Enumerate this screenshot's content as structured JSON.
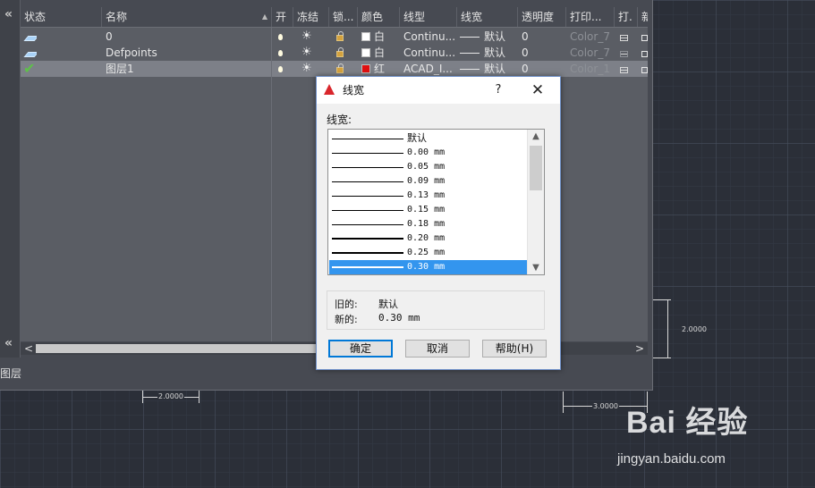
{
  "palette": {
    "columns": [
      "状态",
      "名称",
      "开",
      "冻结",
      "锁...",
      "颜色",
      "线型",
      "线宽",
      "透明度",
      "打印...",
      "打.",
      "新"
    ],
    "layers": [
      {
        "name": "0",
        "color_name": "白",
        "color_hex": "#ffffff",
        "linetype": "Continu...",
        "lineweight": "默认",
        "transparency": "0",
        "plot_style": "Color_7",
        "current": false
      },
      {
        "name": "Defpoints",
        "color_name": "白",
        "color_hex": "#ffffff",
        "linetype": "Continu...",
        "lineweight": "默认",
        "transparency": "0",
        "plot_style": "Color_7",
        "current": false
      },
      {
        "name": "图层1",
        "color_name": "红",
        "color_hex": "#e01010",
        "linetype": "ACAD_I...",
        "lineweight": "默认",
        "transparency": "0",
        "plot_style": "Color_1",
        "current": true
      }
    ],
    "side_label": "图层"
  },
  "dialog": {
    "title": "线宽",
    "help": "?",
    "close": "✕",
    "list_label": "线宽:",
    "options": [
      "默认",
      "0.00 mm",
      "0.05 mm",
      "0.09 mm",
      "0.13 mm",
      "0.15 mm",
      "0.18 mm",
      "0.20 mm",
      "0.25 mm",
      "0.30 mm"
    ],
    "selected_index": 9,
    "old_label": "旧的:",
    "old_value": "默认",
    "new_label": "新的:",
    "new_value": "0.30 mm",
    "ok": "确定",
    "cancel": "取消",
    "help_button": "帮助(H)"
  },
  "drawing": {
    "dim_height": "2.0000",
    "dim_width_left": "2.0000",
    "dim_width_right": "3.0000"
  },
  "watermark": {
    "logo": "Bai 经验",
    "url": "jingyan.baidu.com"
  },
  "colors": {
    "selected_row": "#7d8088",
    "list_selection": "#3395ee",
    "default_button_border": "#0078d7"
  }
}
